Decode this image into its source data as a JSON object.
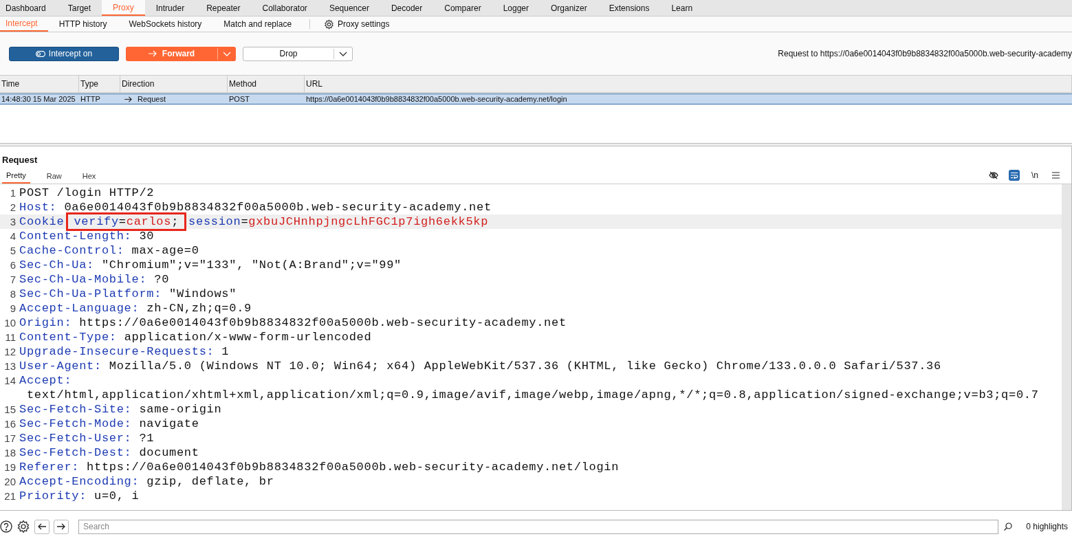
{
  "main_tabs": [
    {
      "label": "Dashboard",
      "selected": false
    },
    {
      "label": "Target",
      "selected": false
    },
    {
      "label": "Proxy",
      "selected": true
    },
    {
      "label": "Intruder",
      "selected": false
    },
    {
      "label": "Repeater",
      "selected": false
    },
    {
      "label": "Collaborator",
      "selected": false
    },
    {
      "label": "Sequencer",
      "selected": false
    },
    {
      "label": "Decoder",
      "selected": false
    },
    {
      "label": "Comparer",
      "selected": false
    },
    {
      "label": "Logger",
      "selected": false
    },
    {
      "label": "Organizer",
      "selected": false
    },
    {
      "label": "Extensions",
      "selected": false
    },
    {
      "label": "Learn",
      "selected": false
    }
  ],
  "sub_tabs": [
    {
      "label": "Intercept",
      "selected": true
    },
    {
      "label": "HTTP history",
      "selected": false
    },
    {
      "label": "WebSockets history",
      "selected": false
    },
    {
      "label": "Match and replace",
      "selected": false
    }
  ],
  "proxy_settings": "Proxy settings",
  "toolbar": {
    "intercept": {
      "label": "Intercept on",
      "on": true
    },
    "forward": "Forward",
    "drop": "Drop",
    "request_to": "Request to https://0a6e0014043f0b9b8834832f00a5000b.web-security-academy"
  },
  "table": {
    "columns": [
      "Time",
      "Type",
      "Direction",
      "Method",
      "URL"
    ],
    "rows": [
      {
        "selected": true,
        "cells": [
          "14:48:30 15 Mar 2025",
          "HTTP",
          "Request",
          "POST",
          "https://0a6e0014043f0b9b8834832f00a5000b.web-security-academy.net/login"
        ]
      }
    ]
  },
  "request": {
    "title": "Request",
    "tabs": [
      {
        "label": "Pretty",
        "selected": true
      },
      {
        "label": "Raw",
        "selected": false
      },
      {
        "label": "Hex",
        "selected": false
      }
    ],
    "tools": [
      {
        "kind": "hide",
        "on": false
      },
      {
        "kind": "wrap",
        "on": true
      },
      {
        "kind": "newline",
        "label": "\\n",
        "on": false
      },
      {
        "kind": "menu",
        "on": false
      }
    ],
    "lines": [
      {
        "number": "1",
        "highlighted": false,
        "segments": [
          {
            "kind": "plain",
            "text": "POST /login HTTP/2"
          }
        ]
      },
      {
        "number": "2",
        "highlighted": false,
        "segments": [
          {
            "kind": "name",
            "text": "Host:"
          },
          {
            "kind": "plain",
            "text": " 0a6e0014043f0b9b8834832f00a5000b.web-security-academy.net"
          }
        ]
      },
      {
        "number": "3",
        "highlighted": true,
        "segments": [
          {
            "kind": "name",
            "text": "Cookie"
          },
          {
            "kind": "box",
            "segments": [
              {
                "kind": "cookie-name",
                "text": "verify"
              },
              {
                "kind": "plain",
                "text": "="
              },
              {
                "kind": "cookie-value",
                "text": "carlos"
              },
              {
                "kind": "plain",
                "text": ";"
              }
            ]
          },
          {
            "kind": "cookie-name",
            "text": "session"
          },
          {
            "kind": "plain",
            "text": "="
          },
          {
            "kind": "cookie-value",
            "text": "gxbuJCHnhpjngcLhFGC1p7igh6ekk5kp"
          }
        ]
      },
      {
        "number": "4",
        "highlighted": false,
        "segments": [
          {
            "kind": "name",
            "text": "Content-Length:"
          },
          {
            "kind": "plain",
            "text": " 30"
          }
        ]
      },
      {
        "number": "5",
        "highlighted": false,
        "segments": [
          {
            "kind": "name",
            "text": "Cache-Control:"
          },
          {
            "kind": "plain",
            "text": " max-age=0"
          }
        ]
      },
      {
        "number": "6",
        "highlighted": false,
        "segments": [
          {
            "kind": "name",
            "text": "Sec-Ch-Ua:"
          },
          {
            "kind": "plain",
            "text": " \"Chromium\";v=\"133\", \"Not(A:Brand\";v=\"99\""
          }
        ]
      },
      {
        "number": "7",
        "highlighted": false,
        "segments": [
          {
            "kind": "name",
            "text": "Sec-Ch-Ua-Mobile:"
          },
          {
            "kind": "plain",
            "text": " ?0"
          }
        ]
      },
      {
        "number": "8",
        "highlighted": false,
        "segments": [
          {
            "kind": "name",
            "text": "Sec-Ch-Ua-Platform:"
          },
          {
            "kind": "plain",
            "text": " \"Windows\""
          }
        ]
      },
      {
        "number": "9",
        "highlighted": false,
        "segments": [
          {
            "kind": "name",
            "text": "Accept-Language:"
          },
          {
            "kind": "plain",
            "text": " zh-CN,zh;q=0.9"
          }
        ]
      },
      {
        "number": "10",
        "highlighted": false,
        "segments": [
          {
            "kind": "name",
            "text": "Origin:"
          },
          {
            "kind": "plain",
            "text": " https://0a6e0014043f0b9b8834832f00a5000b.web-security-academy.net"
          }
        ]
      },
      {
        "number": "11",
        "highlighted": false,
        "segments": [
          {
            "kind": "name",
            "text": "Content-Type:"
          },
          {
            "kind": "plain",
            "text": " application/x-www-form-urlencoded"
          }
        ]
      },
      {
        "number": "12",
        "highlighted": false,
        "segments": [
          {
            "kind": "name",
            "text": "Upgrade-Insecure-Requests:"
          },
          {
            "kind": "plain",
            "text": " 1"
          }
        ]
      },
      {
        "number": "13",
        "highlighted": false,
        "segments": [
          {
            "kind": "name",
            "text": "User-Agent:"
          },
          {
            "kind": "plain",
            "text": " Mozilla/5.0 (Windows NT 10.0; Win64; x64) AppleWebKit/537.36 (KHTML, like Gecko) Chrome/133.0.0.0 Safari/537.36"
          }
        ]
      },
      {
        "number": "14",
        "highlighted": false,
        "segments": [
          {
            "kind": "name",
            "text": "Accept:"
          },
          {
            "kind": "plain",
            "text": " text/html,application/xhtml+xml,application/xml;q=0.9,image/avif,image/webp,image/apng,*/*;q=0.8,application/signed-exchange;v=b3;q=0.7"
          }
        ]
      },
      {
        "number": "15",
        "highlighted": false,
        "segments": [
          {
            "kind": "name",
            "text": "Sec-Fetch-Site:"
          },
          {
            "kind": "plain",
            "text": " same-origin"
          }
        ]
      },
      {
        "number": "16",
        "highlighted": false,
        "segments": [
          {
            "kind": "name",
            "text": "Sec-Fetch-Mode:"
          },
          {
            "kind": "plain",
            "text": " navigate"
          }
        ]
      },
      {
        "number": "17",
        "highlighted": false,
        "segments": [
          {
            "kind": "name",
            "text": "Sec-Fetch-User:"
          },
          {
            "kind": "plain",
            "text": " ?1"
          }
        ]
      },
      {
        "number": "18",
        "highlighted": false,
        "segments": [
          {
            "kind": "name",
            "text": "Sec-Fetch-Dest:"
          },
          {
            "kind": "plain",
            "text": " document"
          }
        ]
      },
      {
        "number": "19",
        "highlighted": false,
        "segments": [
          {
            "kind": "name",
            "text": "Referer:"
          },
          {
            "kind": "plain",
            "text": " https://0a6e0014043f0b9b8834832f00a5000b.web-security-academy.net/login"
          }
        ]
      },
      {
        "number": "20",
        "highlighted": false,
        "segments": [
          {
            "kind": "name",
            "text": "Accept-Encoding:"
          },
          {
            "kind": "plain",
            "text": " gzip, deflate, br"
          }
        ]
      },
      {
        "number": "21",
        "highlighted": false,
        "segments": [
          {
            "kind": "name",
            "text": "Priority:"
          },
          {
            "kind": "plain",
            "text": " u=0, i"
          }
        ]
      }
    ]
  },
  "bottom_bar": {
    "search": {
      "placeholder": "Search"
    },
    "highlights": "0 highlights"
  }
}
